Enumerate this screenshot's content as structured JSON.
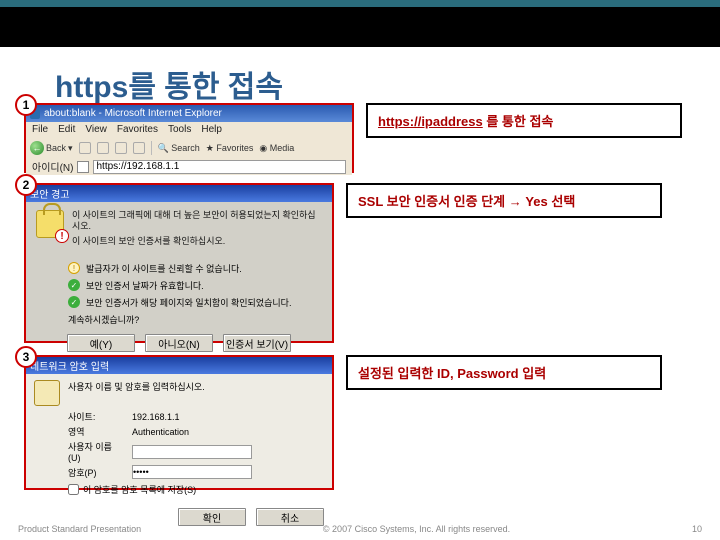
{
  "title": "https를 통한 접속",
  "steps": {
    "s1": {
      "num": "1",
      "desc_prefix": "https://ipaddress",
      "desc_rest": " 를 통한 접속"
    },
    "s2": {
      "num": "2",
      "desc": "SSL 보안 인증서 인증 단계 → Yes 선택"
    },
    "s3": {
      "num": "3",
      "desc": "설정된 입력한 ID, Password 입력"
    }
  },
  "ie": {
    "title": "about:blank - Microsoft Internet Explorer",
    "menu": {
      "file": "File",
      "edit": "Edit",
      "view": "View",
      "favorites": "Favorites",
      "tools": "Tools",
      "help": "Help"
    },
    "toolbar": {
      "back": "Back",
      "search": "Search",
      "favorites": "Favorites",
      "media": "Media"
    },
    "address_label": "아이디(N)",
    "address_value": "https://192.168.1.1"
  },
  "alert": {
    "title": "보안 경고",
    "msg1": "이 사이트의 그래픽에 대해 더 높은 보안이 허용되었는지 확인하십시오.",
    "msg2": "이 사이트의 보안 인증서를 확인하십시오.",
    "line_warn": "발급자가 이 사이트를 신뢰할 수 없습니다.",
    "line_ok1": "보안 인증서 날짜가 유효합니다.",
    "line_ok2": "보안 인증서가 해당 페이지와 일치함이 확인되었습니다.",
    "q": "계속하시겠습니까?",
    "yes": "예(Y)",
    "no": "아니오(N)",
    "view": "인증서 보기(V)"
  },
  "auth": {
    "title": "네트워크 암호 입력",
    "prompt": "사용자 이름 및 암호를 입력하십시오.",
    "site_l": "사이트:",
    "site_v": "192.168.1.1",
    "realm_l": "영역",
    "realm_v": "Authentication",
    "user_l": "사용자 이름(U)",
    "user_v": "",
    "pass_l": "암호(P)",
    "pass_v": "•••••",
    "remember": "이 암호를 암호 목록에 저장(S)",
    "ok": "확인",
    "cancel": "취소"
  },
  "footer": {
    "left": "Product Standard Presentation",
    "mid": "© 2007 Cisco Systems, Inc. All rights reserved.",
    "right": "10"
  }
}
